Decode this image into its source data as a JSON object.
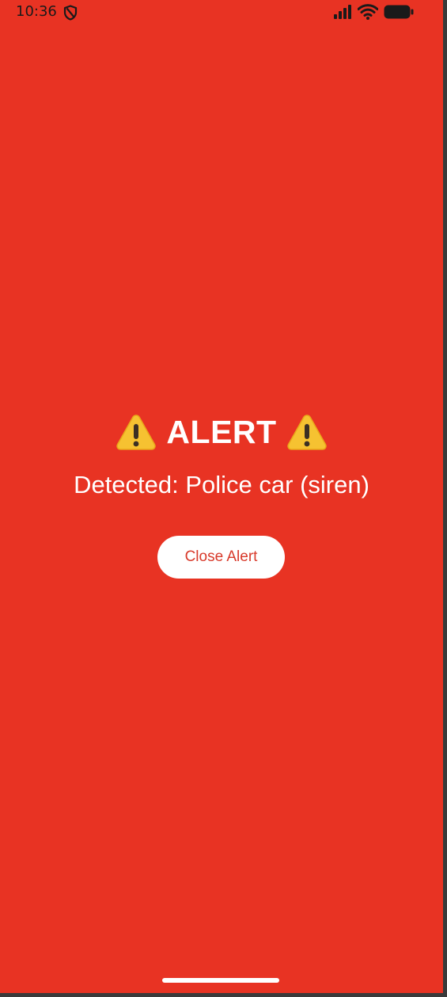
{
  "status_bar": {
    "time": "10:36",
    "icons": [
      "shield-icon",
      "signal-icon",
      "wifi-icon",
      "battery-icon"
    ]
  },
  "alert": {
    "title": "ALERT",
    "title_icon": "warning-icon",
    "message": "Detected: Police car (siren)",
    "close_label": "Close Alert"
  },
  "colors": {
    "background": "#E83323",
    "button_background": "#FFFFFF",
    "button_text": "#D83A2B",
    "text": "#FFFFFF"
  }
}
